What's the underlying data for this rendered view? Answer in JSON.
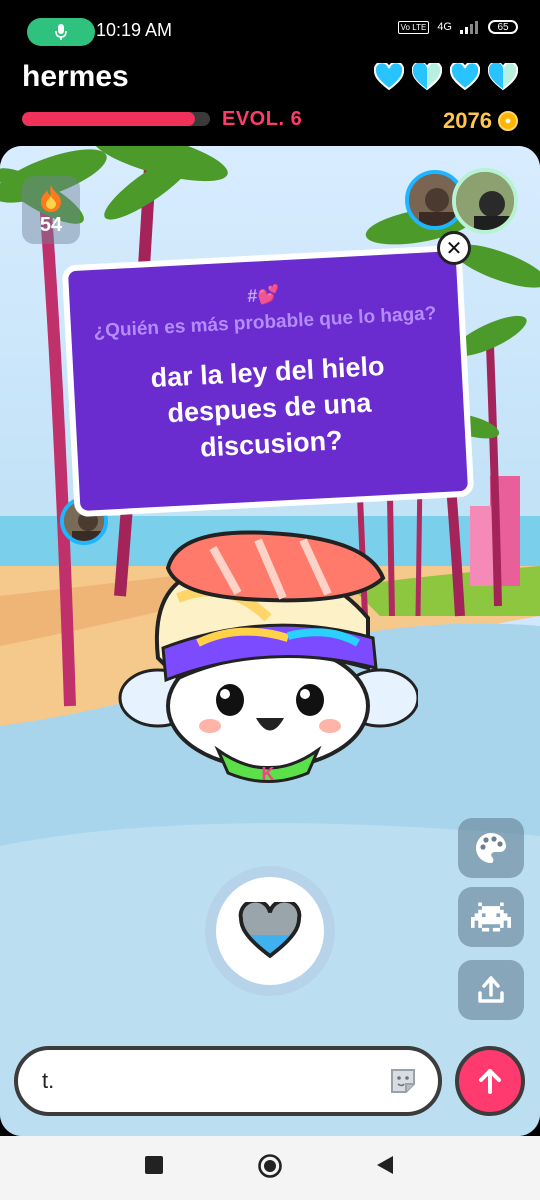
{
  "status_bar": {
    "time": "10:19 AM",
    "network": "4G",
    "volte": "Vo LTE",
    "battery": "65",
    "icons": [
      "mic-icon",
      "signal-icon",
      "battery-icon"
    ]
  },
  "header": {
    "username": "hermes",
    "evolution_label": "EVOL. 6",
    "evolution_progress": 0.92,
    "coins": "2076",
    "hearts": [
      1.0,
      0.5,
      1.0,
      0.5
    ],
    "colors": {
      "accent_pink": "#ff3b6b",
      "coin_gold": "#ffc64a",
      "heart_blue": "#29c4ff"
    }
  },
  "streak": {
    "icon": "fire-icon",
    "count": "54"
  },
  "question_card": {
    "tag": "#💕",
    "subtitle": "¿Quién es más probable que lo haga?",
    "question": "dar la ley del hielo despues de una discusion?",
    "background": "#6a2bcf"
  },
  "side_buttons": [
    "palette-icon",
    "space-invader-icon",
    "share-icon"
  ],
  "message_input": {
    "value": "t.",
    "icon": "sticker-icon"
  },
  "send_button": {
    "icon": "arrow-up-icon",
    "color": "#ff3a6e"
  },
  "nav": [
    "recents-square-icon",
    "home-circle-icon",
    "back-triangle-icon"
  ]
}
